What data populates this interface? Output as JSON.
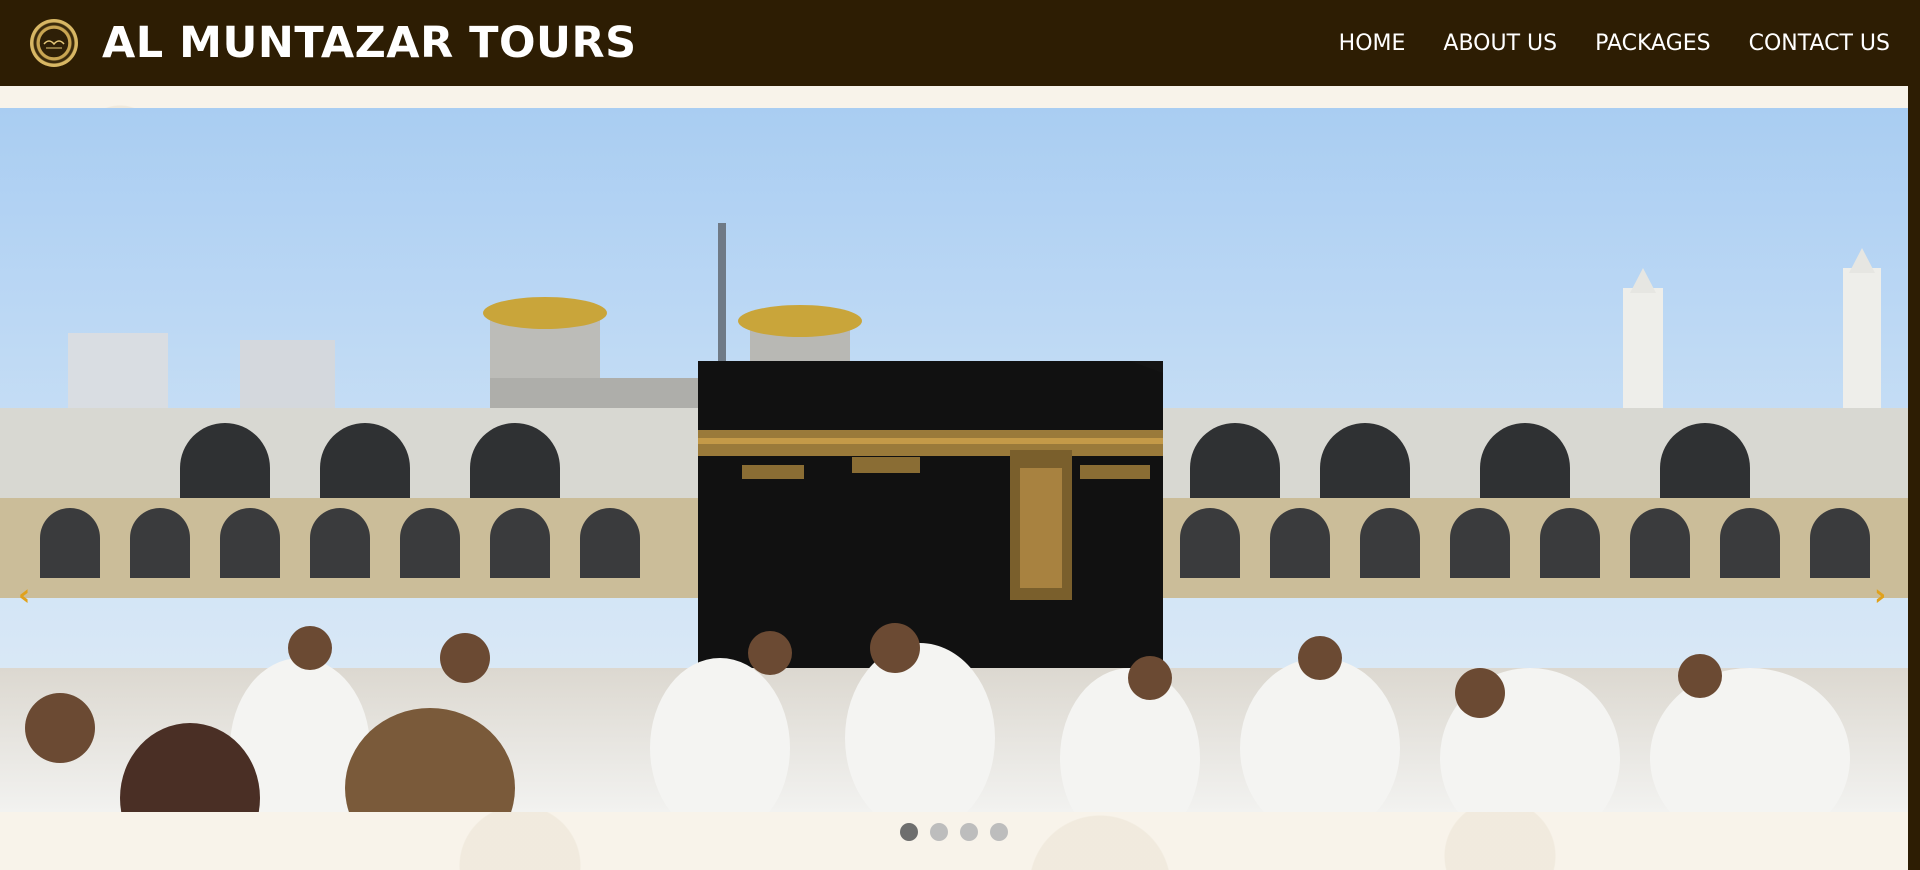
{
  "brand": {
    "title": "AL MUNTAZAR TOURS",
    "logo_icon": "ornamental-seal-icon"
  },
  "nav": {
    "items": [
      {
        "label": "HOME"
      },
      {
        "label": "ABOUT US"
      },
      {
        "label": "PACKAGES"
      },
      {
        "label": "CONTACT US"
      }
    ]
  },
  "carousel": {
    "prev_icon": "‹",
    "next_icon": "›",
    "slide_count": 4,
    "active_index": 0,
    "slide_alt": "kaaba-pilgrims-photo"
  },
  "colors": {
    "navbar_bg": "#2d1d03",
    "nav_text": "#ffffff",
    "arrow": "#e0a11b",
    "dot_active": "#6e6e6e",
    "dot_inactive": "#bdbdbd"
  }
}
